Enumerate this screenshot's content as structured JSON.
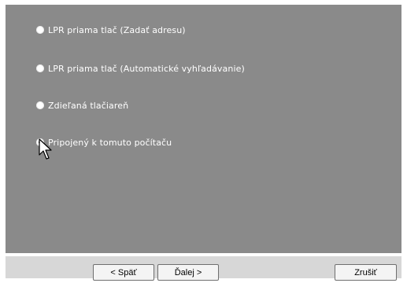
{
  "wizard": {
    "options": [
      {
        "label": "LPR priama tlač (Zadať adresu)",
        "selected": false
      },
      {
        "label": "LPR priama tlač (Automatické vyhľadávanie)",
        "selected": false
      },
      {
        "label": "Zdieľaná tlačiareň",
        "selected": false
      },
      {
        "label": "Pripojený k tomuto počítaču",
        "selected": true
      }
    ],
    "buttons": {
      "back": "< Späť",
      "next": "Ďalej >",
      "cancel": "Zrušiť"
    }
  },
  "colors": {
    "panel_bg": "#8a8a8a",
    "text": "#ffffff",
    "button_bar": "#d7d7d7"
  }
}
